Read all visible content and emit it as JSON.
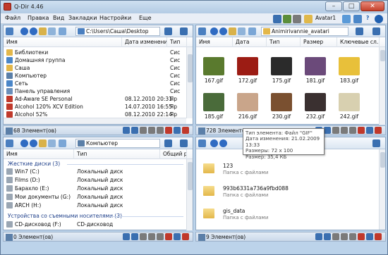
{
  "window": {
    "title": "Q-Dir 4.46",
    "min": "–",
    "max": "□",
    "close": "✕"
  },
  "menu": {
    "items": [
      "Файл",
      "Правка",
      "Вид",
      "Закладки",
      "Настройки",
      "Еще"
    ],
    "avatar": "Avatar1",
    "question": "?"
  },
  "pane_tl": {
    "path": "C:\\Users\\Саша\\Desktop",
    "headers": [
      "Имя",
      "Дата изменения",
      "Тип"
    ],
    "rows": [
      {
        "name": "Библиотеки",
        "date": "",
        "type": "Сис"
      },
      {
        "name": "Домашняя группа",
        "date": "",
        "type": "Сис"
      },
      {
        "name": "Саша",
        "date": "",
        "type": "Сис"
      },
      {
        "name": "Компьютер",
        "date": "",
        "type": "Сис"
      },
      {
        "name": "Сеть",
        "date": "",
        "type": "Сис"
      },
      {
        "name": "Панель управления",
        "date": "",
        "type": "Сис"
      },
      {
        "name": "Ad-Aware SE Personal",
        "date": "08.12.2010 20:31",
        "type": "Яр"
      },
      {
        "name": "Alcohol 120% XCV Edition",
        "date": "14.07.2010 16:55",
        "type": "Яр"
      },
      {
        "name": "Alcohol 52%",
        "date": "08.12.2010 22:14",
        "type": "Яр"
      }
    ],
    "status": "68 Элемент(ов)"
  },
  "pane_tr": {
    "path": "Animirivannie_avatari",
    "dropdown": "Avatar1",
    "headers": [
      "Имя",
      "Дата",
      "Тип",
      "Размер",
      "Ключевые сл..."
    ],
    "thumbs": [
      {
        "label": "167.gif",
        "color": "#5a7a2e"
      },
      {
        "label": "172.gif",
        "color": "#9c1c14"
      },
      {
        "label": "175.gif",
        "color": "#2b2b2b"
      },
      {
        "label": "181.gif",
        "color": "#6b4a7a"
      },
      {
        "label": "183.gif",
        "color": "#e8c03a"
      },
      {
        "label": "185.gif",
        "color": "#4a6b3a"
      },
      {
        "label": "216.gif",
        "color": "#c9a58a"
      },
      {
        "label": "230.gif",
        "color": "#7a5030"
      },
      {
        "label": "232.gif",
        "color": "#3a3030"
      },
      {
        "label": "242.gif",
        "color": "#d8d0b0"
      }
    ],
    "status": "728 Элемент(ов)"
  },
  "tooltip": {
    "lines": [
      "Тип элемента: Файл \"GIF\"",
      "Дата изменения: 21.02.2009 13:33",
      "Размеры: 72 x 100",
      "Размер: 35,4 КБ"
    ]
  },
  "pane_bl": {
    "path": "Компьютер",
    "headers": [
      "Имя",
      "Тип",
      "Общий р"
    ],
    "group1": "Жесткие диски (3)",
    "drives": [
      {
        "name": "Win7 (C:)",
        "type": "Локальный диск"
      },
      {
        "name": "Films (D:)",
        "type": "Локальный диск"
      },
      {
        "name": "Барахло (E:)",
        "type": "Локальный диск"
      },
      {
        "name": "Мои документы (G:)",
        "type": "Локальный диск"
      },
      {
        "name": "ARCH (H:)",
        "type": "Локальный диск"
      }
    ],
    "group2": "Устройства со съемными носителями (3)",
    "cd": {
      "name": "CD-дисковод (F:)",
      "type": "CD-дисковод"
    },
    "status": "0 Элемент(ов)"
  },
  "pane_br": {
    "path": "123",
    "folders": [
      {
        "name": "123",
        "sub": "Папка с файлами"
      },
      {
        "name": "993b6331a736a9fbd088",
        "sub": "Папка с файлами"
      },
      {
        "name": "gis_data",
        "sub": "Папка с файлами"
      }
    ],
    "status": "9 Элемент(ов)"
  },
  "colors": {
    "accent": "#1f5fb0",
    "titlebar": "#bcd3ea",
    "group": "#1e3f8a"
  },
  "icons": [
    "back-icon",
    "forward-icon",
    "up-icon",
    "folder-icon",
    "view-icon",
    "computer-icon",
    "drive-icon",
    "cut-icon",
    "copy-icon",
    "paste-icon",
    "delete-icon",
    "edit-icon"
  ]
}
